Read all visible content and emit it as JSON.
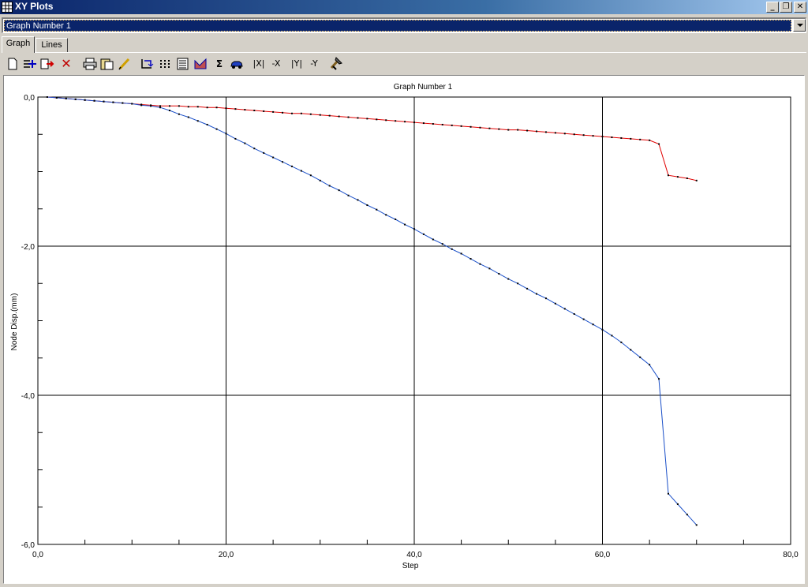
{
  "window": {
    "title": "XY Plots",
    "buttons": [
      "_",
      "❐",
      "✕"
    ]
  },
  "graph_selector": {
    "value": "Graph Number 1"
  },
  "tabs": [
    {
      "label": "Graph",
      "active": true
    },
    {
      "label": "Lines",
      "active": false
    }
  ],
  "toolbar": {
    "icons": [
      "new-icon",
      "add-line-icon",
      "import-icon",
      "delete-icon",
      "print-icon",
      "copy-icon",
      "pen-icon",
      "refresh-icon",
      "grid-icon",
      "table-icon",
      "fill-icon",
      "sum-icon",
      "car-icon",
      "abs-x-icon",
      "neg-x-icon",
      "abs-y-icon",
      "neg-y-icon",
      "tools-icon"
    ],
    "labels": {
      "sum": "Σ",
      "abs_x": "|X|",
      "neg_x": "-X",
      "abs_y": "|Y|",
      "neg_y": "-Y"
    }
  },
  "chart_data": {
    "type": "line",
    "title": "Graph Number 1",
    "xlabel": "Step",
    "ylabel": "Node Disp.(mm)",
    "xlim": [
      0,
      80
    ],
    "ylim": [
      -6,
      0
    ],
    "xticks_major": [
      "0,0",
      "20,0",
      "40,0",
      "60,0",
      "80,0"
    ],
    "yticks_major": [
      "0,0",
      "-2,0",
      "-4,0",
      "-6,0"
    ],
    "grid": true,
    "series": [
      {
        "color": "#e00000",
        "x": [
          1,
          2,
          3,
          4,
          5,
          6,
          7,
          8,
          9,
          10,
          11,
          12,
          13,
          14,
          15,
          16,
          17,
          18,
          19,
          20,
          21,
          22,
          23,
          24,
          25,
          26,
          27,
          28,
          29,
          30,
          31,
          32,
          33,
          34,
          35,
          36,
          37,
          38,
          39,
          40,
          41,
          42,
          43,
          44,
          45,
          46,
          47,
          48,
          49,
          50,
          51,
          52,
          53,
          54,
          55,
          56,
          57,
          58,
          59,
          60,
          61,
          62,
          63,
          64,
          65,
          66,
          67,
          68,
          69,
          70
        ],
        "y": [
          0.0,
          -0.01,
          -0.02,
          -0.03,
          -0.04,
          -0.05,
          -0.06,
          -0.07,
          -0.08,
          -0.09,
          -0.1,
          -0.11,
          -0.12,
          -0.12,
          -0.12,
          -0.13,
          -0.13,
          -0.14,
          -0.14,
          -0.15,
          -0.16,
          -0.17,
          -0.18,
          -0.19,
          -0.2,
          -0.21,
          -0.22,
          -0.22,
          -0.23,
          -0.24,
          -0.25,
          -0.26,
          -0.27,
          -0.28,
          -0.29,
          -0.3,
          -0.31,
          -0.32,
          -0.33,
          -0.34,
          -0.35,
          -0.36,
          -0.37,
          -0.38,
          -0.39,
          -0.4,
          -0.41,
          -0.42,
          -0.43,
          -0.44,
          -0.44,
          -0.45,
          -0.46,
          -0.47,
          -0.48,
          -0.49,
          -0.5,
          -0.51,
          -0.52,
          -0.53,
          -0.54,
          -0.55,
          -0.56,
          -0.57,
          -0.58,
          -0.63,
          -1.05,
          -1.07,
          -1.09,
          -1.12
        ]
      },
      {
        "color": "#1a4fc8",
        "x": [
          1,
          2,
          3,
          4,
          5,
          6,
          7,
          8,
          9,
          10,
          11,
          12,
          13,
          14,
          15,
          16,
          17,
          18,
          19,
          20,
          21,
          22,
          23,
          24,
          25,
          26,
          27,
          28,
          29,
          30,
          31,
          32,
          33,
          34,
          35,
          36,
          37,
          38,
          39,
          40,
          41,
          42,
          43,
          44,
          45,
          46,
          47,
          48,
          49,
          50,
          51,
          52,
          53,
          54,
          55,
          56,
          57,
          58,
          59,
          60,
          61,
          62,
          63,
          64,
          65,
          66,
          67,
          68,
          69,
          70
        ],
        "y": [
          0.0,
          -0.01,
          -0.02,
          -0.03,
          -0.04,
          -0.05,
          -0.06,
          -0.07,
          -0.08,
          -0.09,
          -0.11,
          -0.12,
          -0.14,
          -0.18,
          -0.23,
          -0.27,
          -0.32,
          -0.37,
          -0.43,
          -0.49,
          -0.56,
          -0.62,
          -0.69,
          -0.75,
          -0.81,
          -0.87,
          -0.93,
          -0.99,
          -1.05,
          -1.12,
          -1.19,
          -1.25,
          -1.32,
          -1.38,
          -1.45,
          -1.51,
          -1.58,
          -1.64,
          -1.71,
          -1.77,
          -1.84,
          -1.91,
          -1.97,
          -2.04,
          -2.1,
          -2.17,
          -2.24,
          -2.3,
          -2.37,
          -2.44,
          -2.5,
          -2.57,
          -2.64,
          -2.7,
          -2.77,
          -2.84,
          -2.91,
          -2.98,
          -3.05,
          -3.12,
          -3.2,
          -3.29,
          -3.39,
          -3.49,
          -3.59,
          -3.78,
          -5.32,
          -5.46,
          -5.6,
          -5.74
        ]
      }
    ]
  }
}
